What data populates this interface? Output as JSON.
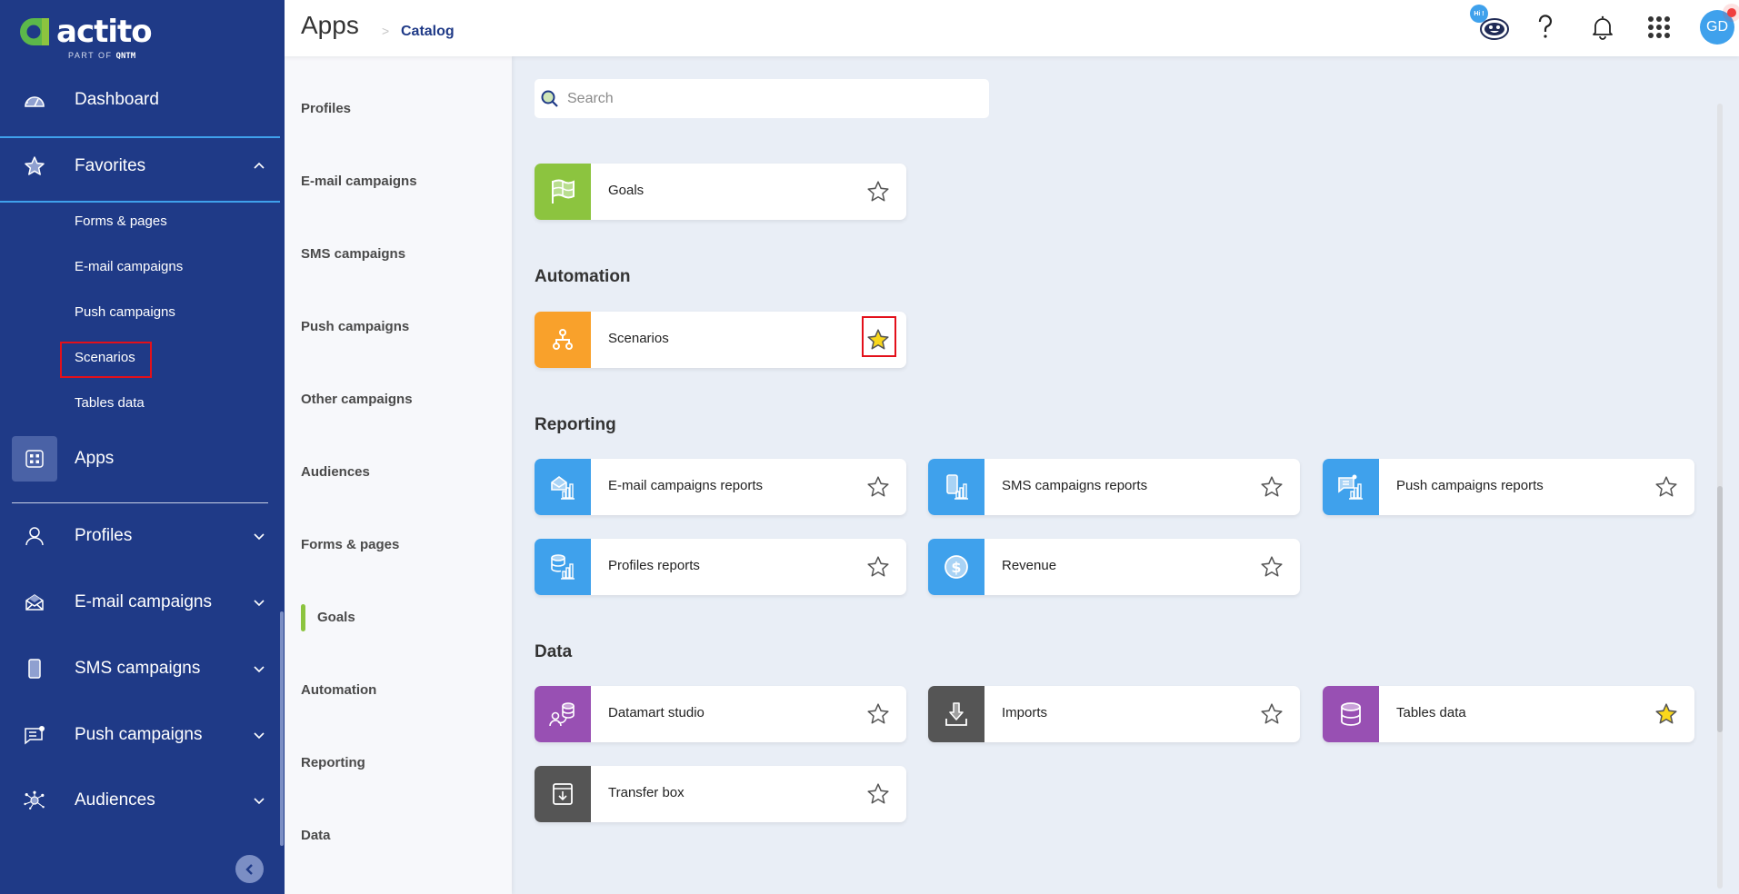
{
  "brand": {
    "name": "actito",
    "tagline_prefix": "PART OF",
    "tagline_brand": "QNTM"
  },
  "sidebar": {
    "dashboard": {
      "label": "Dashboard",
      "icon": "dashboard-gauge-icon"
    },
    "favorites": {
      "label": "Favorites",
      "icon": "star-icon",
      "expanded": true,
      "items": [
        {
          "label": "Forms & pages"
        },
        {
          "label": "E-mail campaigns"
        },
        {
          "label": "Push campaigns"
        },
        {
          "label": "Scenarios",
          "highlighted": true
        },
        {
          "label": "Tables data"
        }
      ]
    },
    "apps": {
      "label": "Apps",
      "icon": "apps-grid-icon",
      "active": true
    },
    "sections": [
      {
        "label": "Profiles",
        "icon": "user-icon"
      },
      {
        "label": "E-mail campaigns",
        "icon": "envelope-icon"
      },
      {
        "label": "SMS campaigns",
        "icon": "phone-icon"
      },
      {
        "label": "Push campaigns",
        "icon": "push-message-icon"
      },
      {
        "label": "Audiences",
        "icon": "network-icon"
      }
    ],
    "collapse_icon": "chevron-left-icon"
  },
  "header": {
    "title": "Apps",
    "separator": ">",
    "breadcrumb": "Catalog",
    "chatbot_badge": "Hi !",
    "avatar_initials": "GD",
    "colors": {
      "accent": "#3fa1ec",
      "notification": "#ef3f3f"
    }
  },
  "categories": {
    "items": [
      {
        "label": "Profiles"
      },
      {
        "label": "E-mail campaigns"
      },
      {
        "label": "SMS campaigns"
      },
      {
        "label": "Push campaigns"
      },
      {
        "label": "Other campaigns"
      },
      {
        "label": "Audiences"
      },
      {
        "label": "Forms & pages"
      },
      {
        "label": "Goals",
        "active": true
      },
      {
        "label": "Automation"
      },
      {
        "label": "Reporting"
      },
      {
        "label": "Data"
      }
    ],
    "active_color": "#8cc43f"
  },
  "search": {
    "placeholder": "Search",
    "value": ""
  },
  "sections": {
    "goals": {
      "cards": [
        {
          "label": "Goals",
          "icon": "flag-icon",
          "color": "#8cc43f",
          "favorite": false
        }
      ]
    },
    "automation": {
      "title": "Automation",
      "cards": [
        {
          "label": "Scenarios",
          "icon": "scenario-tree-icon",
          "color": "#f9a12b",
          "favorite": true,
          "highlighted": true
        }
      ]
    },
    "reporting": {
      "title": "Reporting",
      "cards": [
        {
          "label": "E-mail campaigns reports",
          "icon": "email-report-icon",
          "color": "#3fa1ec",
          "favorite": false
        },
        {
          "label": "SMS campaigns reports",
          "icon": "sms-report-icon",
          "color": "#3fa1ec",
          "favorite": false
        },
        {
          "label": "Push campaigns reports",
          "icon": "push-report-icon",
          "color": "#3fa1ec",
          "favorite": false
        },
        {
          "label": "Profiles reports",
          "icon": "profiles-report-icon",
          "color": "#3fa1ec",
          "favorite": false
        },
        {
          "label": "Revenue",
          "icon": "dollar-icon",
          "color": "#3fa1ec",
          "favorite": false
        }
      ]
    },
    "data": {
      "title": "Data",
      "cards": [
        {
          "label": "Datamart studio",
          "icon": "datamart-icon",
          "color": "#9850b3",
          "favorite": false
        },
        {
          "label": "Imports",
          "icon": "import-icon",
          "color": "#555555",
          "favorite": false
        },
        {
          "label": "Tables data",
          "icon": "database-icon",
          "color": "#9850b3",
          "favorite": true
        },
        {
          "label": "Transfer box",
          "icon": "transfer-box-icon",
          "color": "#555555",
          "favorite": false
        }
      ]
    }
  },
  "colors": {
    "sidebar_bg": "#1f3a87",
    "favorite_star": "#f9d71c",
    "page_bg": "#e9eef6"
  }
}
